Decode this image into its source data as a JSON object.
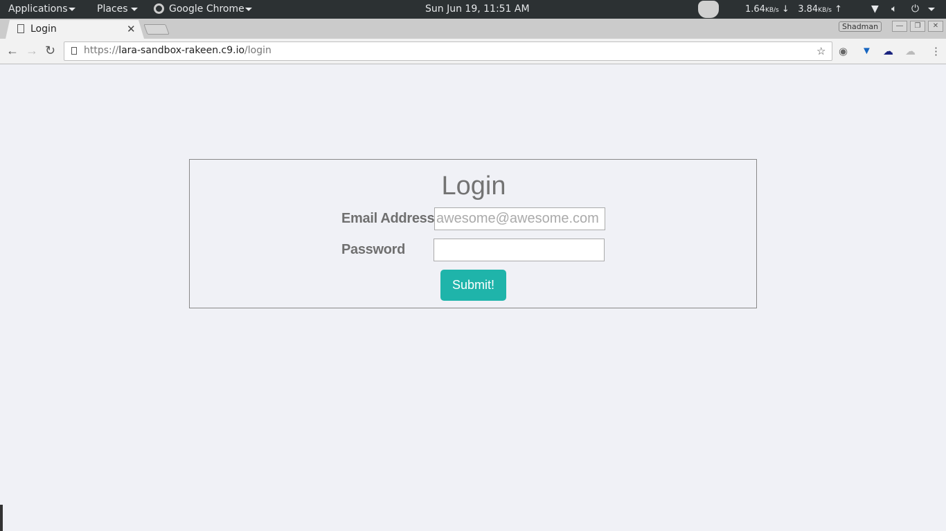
{
  "topbar": {
    "applications": "Applications",
    "places": "Places",
    "app": "Google Chrome",
    "clock": "Sun Jun 19, 11:51 AM",
    "down_speed": "1.64",
    "down_unit": "KB/s",
    "up_speed": "3.84",
    "up_unit": "KB/s"
  },
  "browser": {
    "tab_title": "Login",
    "profile": "Shadman",
    "url_scheme": "https://",
    "url_host": "lara-sandbox-rakeen.c9.io",
    "url_path": "/login"
  },
  "form": {
    "title": "Login",
    "email_label": "Email Address",
    "email_placeholder": "awesome@awesome.com",
    "password_label": "Password",
    "password_value": "",
    "submit_label": "Submit!"
  }
}
